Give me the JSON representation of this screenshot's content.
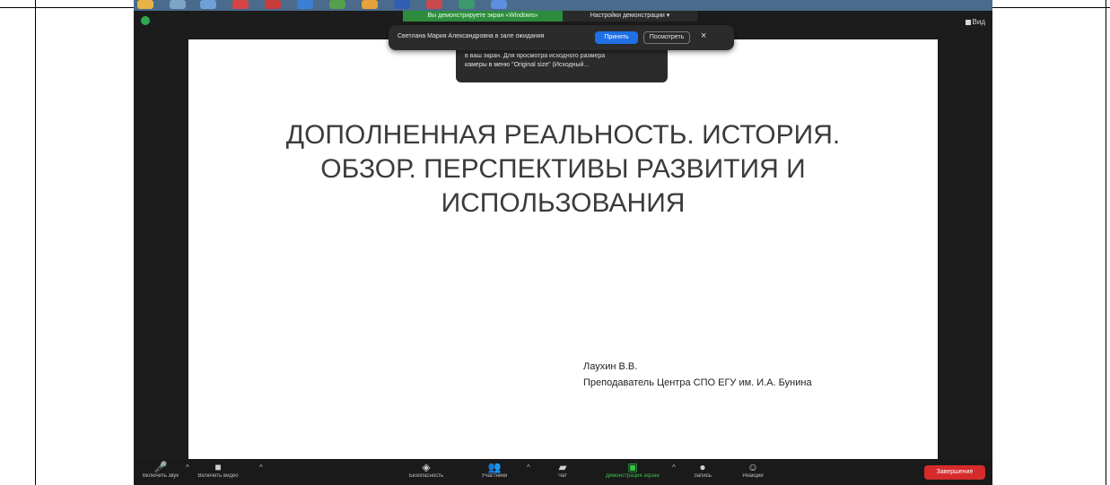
{
  "banner": {
    "share_text": "Вы демонстрируете экран «Windows»",
    "settings_text": "Настройки демонстрации ▾"
  },
  "notification": {
    "text": "Светлана Мария Александровна в зале ожидания",
    "accept_label": "Принять",
    "later_label": "Посмотреть",
    "close_label": "×"
  },
  "tooltip": {
    "line1": "в ваш экран. Для просмотра исходного размера",
    "line2": "камеры в меню \"Original size\" (Исходный..."
  },
  "top_right": {
    "view_label": "Вид"
  },
  "slide": {
    "title_lines": [
      "ДОПОЛНЕННАЯ РЕАЛЬНОСТЬ. ИСТОРИЯ.",
      "ОБЗОР. ПЕРСПЕКТИВЫ РАЗВИТИЯ И",
      "ИСПОЛЬЗОВАНИЯ"
    ],
    "author_name": "Лаухин В.В.",
    "author_role": "Преподаватель Центра СПО ЕГУ им. И.А. Бунина"
  },
  "toolbar": {
    "items": [
      {
        "label": "Включить звук",
        "icon": "microphone-icon"
      },
      {
        "label": "Включить видео",
        "icon": "video-icon"
      },
      {
        "label": "Безопасность",
        "icon": "shield-icon"
      },
      {
        "label": "Участники",
        "icon": "participants-icon"
      },
      {
        "label": "Чат",
        "icon": "chat-icon"
      },
      {
        "label": "Демонстрация экрана",
        "icon": "share-screen-icon"
      },
      {
        "label": "Запись",
        "icon": "record-icon"
      },
      {
        "label": "Реакции",
        "icon": "reactions-icon"
      }
    ],
    "end_label": "Завершение"
  },
  "colors": {
    "share_green": "#2d8c3c",
    "accept_blue": "#1f6fe6",
    "end_red": "#d52b2b"
  }
}
